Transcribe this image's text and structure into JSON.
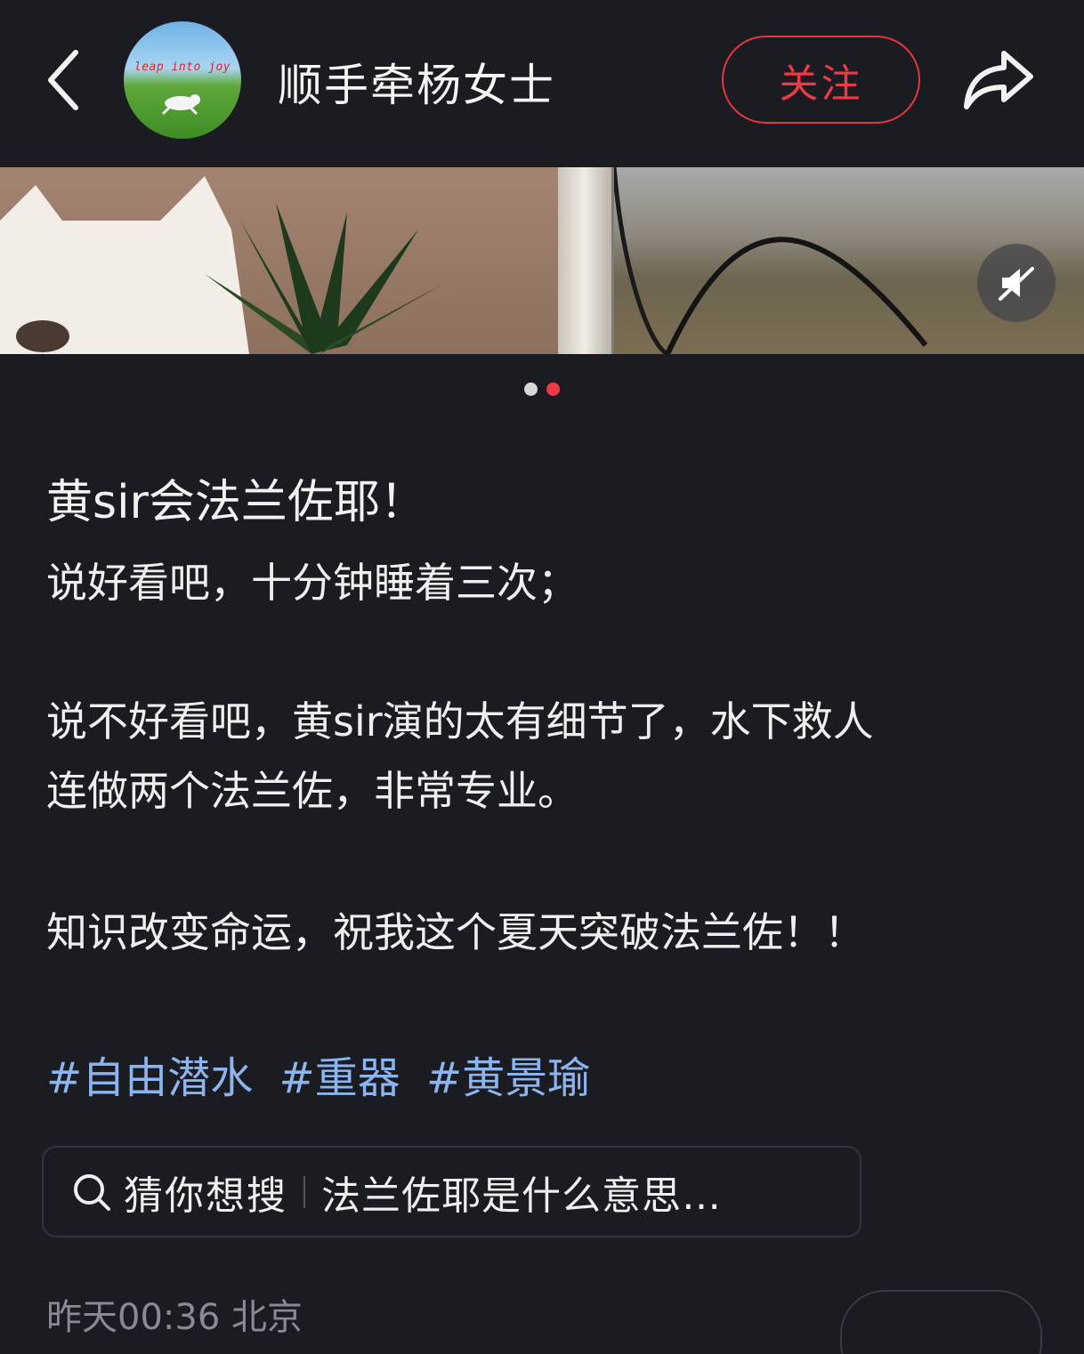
{
  "header": {
    "username": "顺手牵杨女士",
    "avatar_text": "leap into joy",
    "follow_label": "关注"
  },
  "media": {
    "slide_count": 2,
    "active_slide": 2
  },
  "post": {
    "title": "黄sir会法兰佐耶！",
    "lines": [
      "说好看吧，十分钟睡着三次；",
      "说不好看吧，黄sir演的太有细节了，水下救人",
      "连做两个法兰佐，非常专业。",
      "知识改变命运，祝我这个夏天突破法兰佐！！"
    ],
    "tags": [
      "#自由潜水",
      "#重器",
      "#黄景瑜"
    ]
  },
  "search": {
    "label": "猜你想搜",
    "query": "法兰佐耶是什么意思…"
  },
  "meta": {
    "time_location": "昨天00:36 北京"
  },
  "colors": {
    "background": "#1b1b22",
    "accent_red": "#ef3a45",
    "tag_blue": "#8cb4ee",
    "dot_inactive": "#d8d8d8",
    "dot_active": "#ef3a45"
  }
}
